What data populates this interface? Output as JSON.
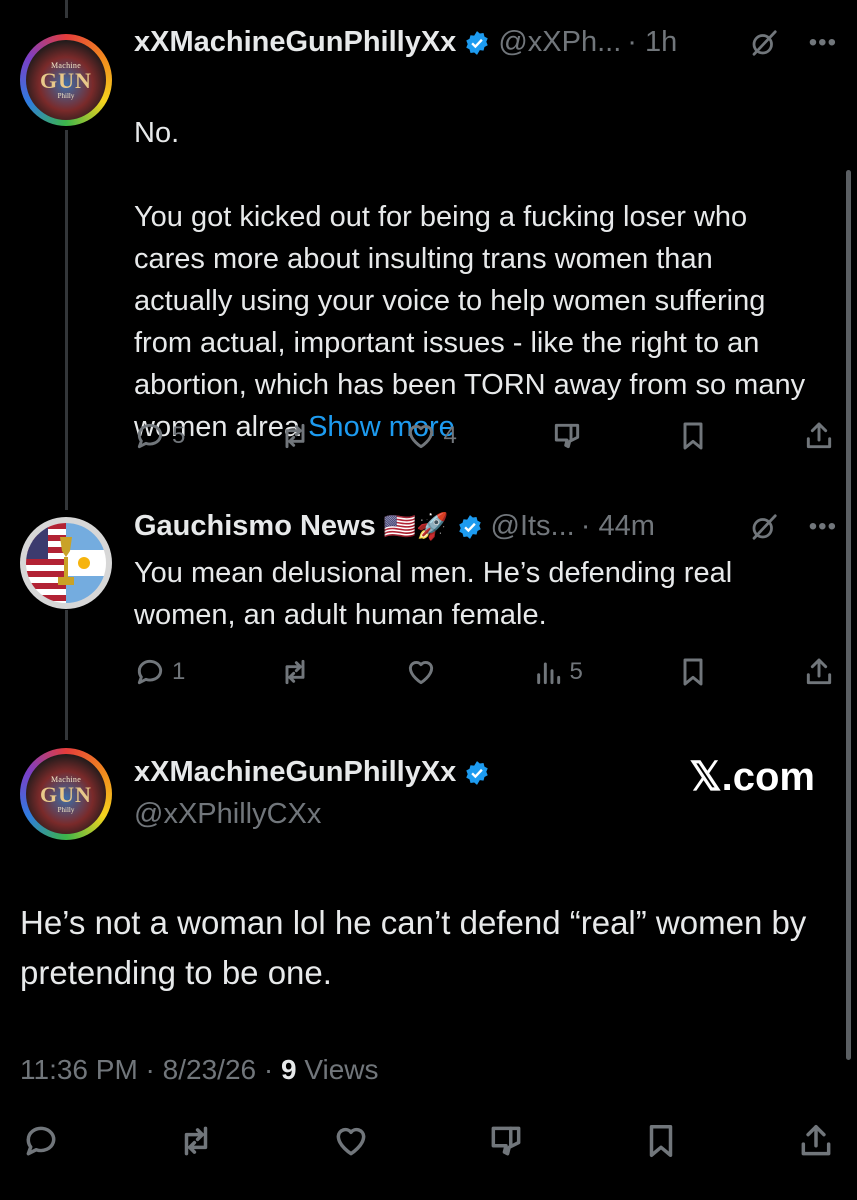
{
  "colors": {
    "background": "#000000",
    "text": "#e7e9ea",
    "muted": "#71767b",
    "link": "#1d9bf0",
    "verified": "#1d9bf0"
  },
  "tweets": [
    {
      "display_name": "xXMachineGunPhillyXx",
      "handle": "@xXPh...",
      "time": "· 1h",
      "avatar": {
        "line1": "Machine",
        "line2": "GUN",
        "line3": "Philly"
      },
      "text": "No.\n\nYou got kicked out for being a fucking loser who cares more about insulting trans women than actually using your voice to help women suffering from actual, important issues - like the right to an abortion, which has been TORN away from so many women alrea ",
      "show_more": "Show more",
      "replies": "5",
      "reposts": "",
      "likes": "4"
    },
    {
      "display_name": "Gauchismo News",
      "emoji": "🇺🇸🚀",
      "handle": "@Its...",
      "time": "· 44m",
      "text": "You mean delusional men. He’s defending real women, an adult human female.",
      "replies": "1",
      "reposts": "",
      "likes": "",
      "views": "5"
    }
  ],
  "main_tweet": {
    "display_name": "xXMachineGunPhillyXx",
    "handle": "@xXPhillyCXx",
    "avatar": {
      "line1": "Machine",
      "line2": "GUN",
      "line3": "Philly"
    },
    "text": "He’s not a woman lol he can’t defend “real” women by pretending to be one.",
    "time": "11:36 PM",
    "date": "8/23/26",
    "views_count": "9",
    "views_label": "Views"
  },
  "watermark": "𝕏.com",
  "icons": [
    "grok-icon",
    "more-icon",
    "reply-icon",
    "repost-icon",
    "like-icon",
    "dislike-icon",
    "views-icon",
    "bookmark-icon",
    "share-icon",
    "verified-icon"
  ]
}
